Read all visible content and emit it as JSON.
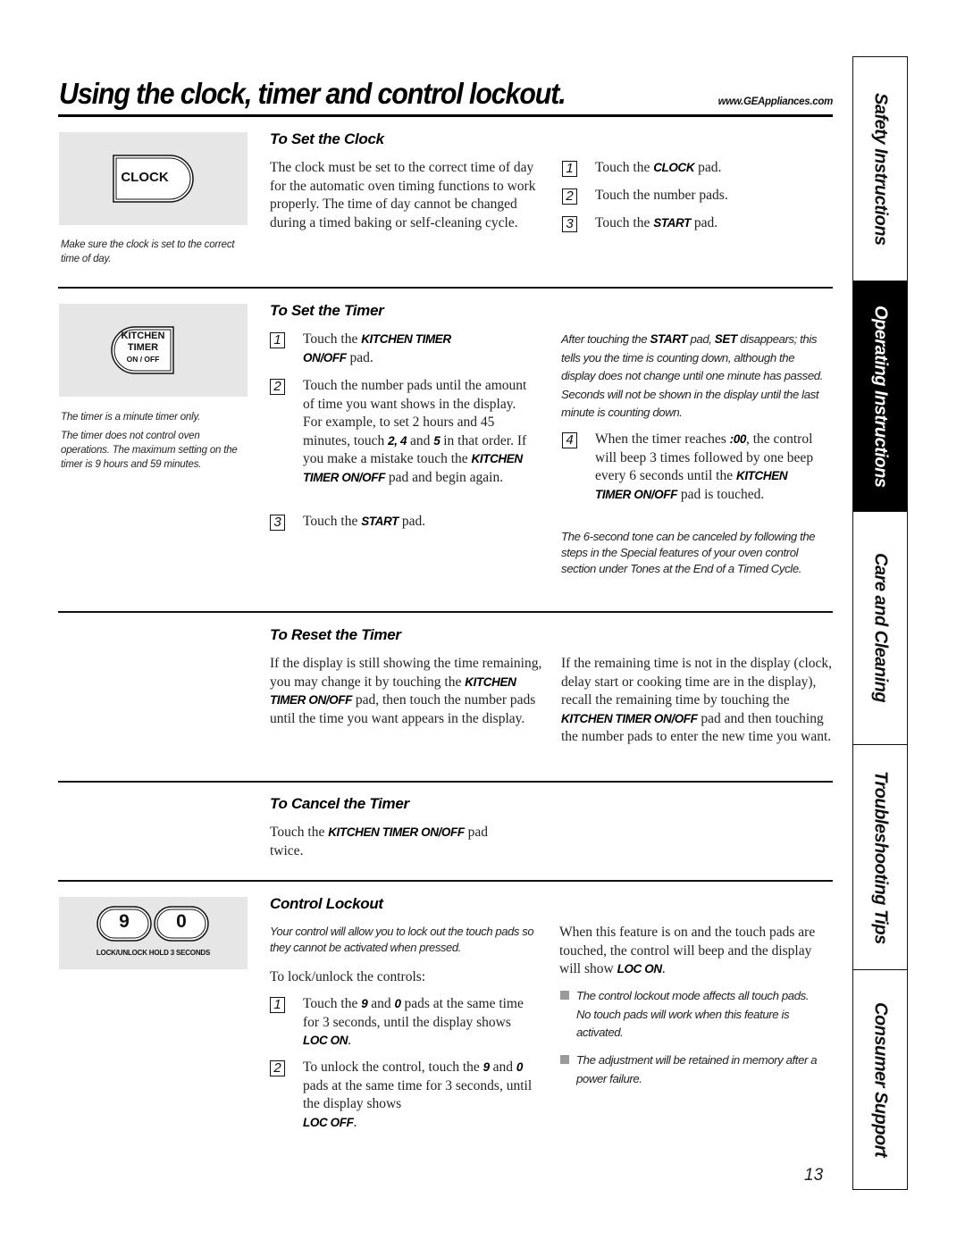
{
  "header": {
    "title": "Using the clock, timer and control lockout.",
    "url": "www.GEAppliances.com"
  },
  "side_tabs": [
    {
      "label": "Safety Instructions",
      "active": false
    },
    {
      "label": "Operating Instructions",
      "active": true
    },
    {
      "label": "Care and Cleaning",
      "active": false
    },
    {
      "label": "Troubleshooting Tips",
      "active": false
    },
    {
      "label": "Consumer Support",
      "active": false
    }
  ],
  "clock": {
    "pad_label": "CLOCK",
    "caption": "Make sure the clock is set to the correct time of day.",
    "heading": "To Set the Clock",
    "intro": "The clock must be set to the correct time of day for the automatic oven timing functions to work properly. The time of day cannot be changed during a timed baking or self-cleaning cycle.",
    "steps": [
      {
        "n": "1",
        "pre": "Touch the ",
        "bold": "CLOCK",
        "post": " pad."
      },
      {
        "n": "2",
        "pre": "Touch the number pads.",
        "bold": "",
        "post": ""
      },
      {
        "n": "3",
        "pre": "Touch the ",
        "bold": "START",
        "post": " pad."
      }
    ]
  },
  "timer": {
    "pad_line1": "KITCHEN",
    "pad_line2": "TIMER",
    "pad_line3": "ON / OFF",
    "caption1": "The timer is a minute timer only.",
    "caption2": "The timer does not control oven operations. The maximum setting on the timer is 9 hours and 59 minutes.",
    "heading": "To Set the Timer",
    "step1": {
      "n": "1",
      "pre": "Touch the ",
      "bold1": "KITCHEN TIMER",
      "bold2": "ON/OFF",
      "post": " pad."
    },
    "step2": {
      "n": "2",
      "t1": "Touch the number pads until the amount of time you want shows in the display. For example, to set 2 hours and 45 minutes, touch ",
      "b1": "2, 4",
      "t2": " and ",
      "b2": "5",
      "t3": " in that order. If you make a mistake touch the ",
      "b3": "KITCHEN TIMER ON/OFF",
      "t4": " pad and begin again."
    },
    "step3": {
      "n": "3",
      "pre": "Touch the ",
      "bold": "START",
      "post": " pad."
    },
    "note1": {
      "t1": "After touching the ",
      "b1": "START",
      "t2": " pad, ",
      "b2": "SET",
      "t3": " disappears; this tells you the time is counting down, although the display does not change until one minute has passed. Seconds will not be shown in the display until the last minute is counting down."
    },
    "step4": {
      "n": "4",
      "t1": "When the timer reaches ",
      "b1": ":00",
      "t2": ", the control will beep 3 times followed by one beep every 6 seconds until the ",
      "b2": "KITCHEN TIMER ON/OFF",
      "t3": " pad is touched."
    },
    "note2": "The 6-second tone can be canceled by following the steps in the Special features of your oven control section under Tones at the End of a Timed Cycle."
  },
  "reset": {
    "heading": "To Reset the Timer",
    "left": {
      "t1": "If the display is still showing the time remaining, you may change it by touching the ",
      "b1": "KITCHEN TIMER ON/OFF",
      "t2": " pad, then touch the number pads until the time you want appears in the display."
    },
    "right": {
      "t1": "If the remaining time is not in the display (clock, delay start or cooking time are in the display), recall the remaining time by touching the ",
      "b1": "KITCHEN TIMER ON/OFF",
      "t2": " pad and then touching the number pads to enter the new time you want."
    }
  },
  "cancel": {
    "heading": "To Cancel the Timer",
    "t1": "Touch the ",
    "b1": "KITCHEN TIMER ON/OFF",
    "t2": " pad twice."
  },
  "lockout": {
    "pad_9": "9",
    "pad_0": "0",
    "pad_caption": "LOCK/UNLOCK HOLD 3 SECONDS",
    "heading": "Control Lockout",
    "intro": "Your control will allow you to lock out the touch pads so they cannot be activated when pressed.",
    "lead": "To lock/unlock the controls:",
    "step1": {
      "n": "1",
      "t1": "Touch the ",
      "b1": "9",
      "t2": " and ",
      "b2": "0",
      "t3": " pads at the same time for 3 seconds, until the display shows ",
      "b3": "LOC ON",
      "t4": "."
    },
    "step2": {
      "n": "2",
      "t1": "To unlock the control, touch the ",
      "b1": "9",
      "t2": " and ",
      "b2": "0",
      "t3": " pads at the same time for 3 seconds, until the display shows ",
      "b3": "LOC OFF",
      "t4": "."
    },
    "right": {
      "t1": "When this feature is on and the touch pads are touched, the control will beep and the display will show ",
      "b1": "LOC ON",
      "t2": "."
    },
    "bullets": [
      "The control lockout mode affects all touch pads. No touch pads will work when this feature is activated.",
      "The adjustment will be retained in memory after a power failure."
    ]
  },
  "page_number": "13"
}
